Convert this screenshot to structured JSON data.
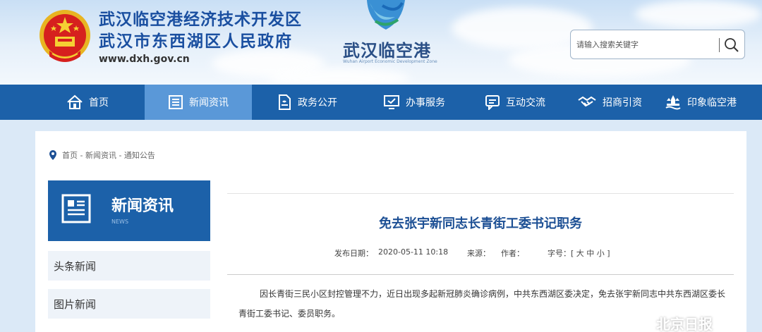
{
  "header": {
    "title_line1": "武汉临空港经济技术开发区",
    "title_line2": "武汉市东西湖区人民政府",
    "url": "www.dxh.gov.cn",
    "logo_text": "武汉临空港",
    "logo_sub": "Wuhan Airport Economic Development Zone",
    "search_placeholder": "请输入搜索关键字"
  },
  "nav": {
    "items": [
      {
        "label": "首页",
        "icon": "home-icon"
      },
      {
        "label": "新闻资讯",
        "icon": "news-icon",
        "active": true
      },
      {
        "label": "政务公开",
        "icon": "document-icon"
      },
      {
        "label": "办事服务",
        "icon": "monitor-check-icon"
      },
      {
        "label": "互动交流",
        "icon": "chat-icon"
      },
      {
        "label": "招商引资",
        "icon": "handshake-icon"
      },
      {
        "label": "印象临空港",
        "icon": "landmark-icon"
      }
    ]
  },
  "breadcrumb": "首页 - 新闻资讯 - 通知公告",
  "sidebar": {
    "heading": "新闻资讯",
    "heading_sub": "NEWS",
    "items": [
      {
        "label": "头条新闻"
      },
      {
        "label": "图片新闻"
      }
    ]
  },
  "article": {
    "title": "免去张宇新同志长青街工委书记职务",
    "publish_label": "发布日期：",
    "publish_date": "2020-05-11 10:18",
    "source_label": "来源：",
    "author_label": "作者：",
    "fontsize_label": "字号：[ 大  中  小 ]",
    "body": "因长青街三民小区封控管理不力，近日出现多起新冠肺炎确诊病例，中共东西湖区委决定，免去张宇新同志中共东西湖区委长青街工委书记、委员职务。"
  },
  "watermark": "北京日报",
  "colors": {
    "nav_bg": "#1c61a9",
    "nav_active": "#5a98d8",
    "title_blue": "#1c4f94"
  }
}
